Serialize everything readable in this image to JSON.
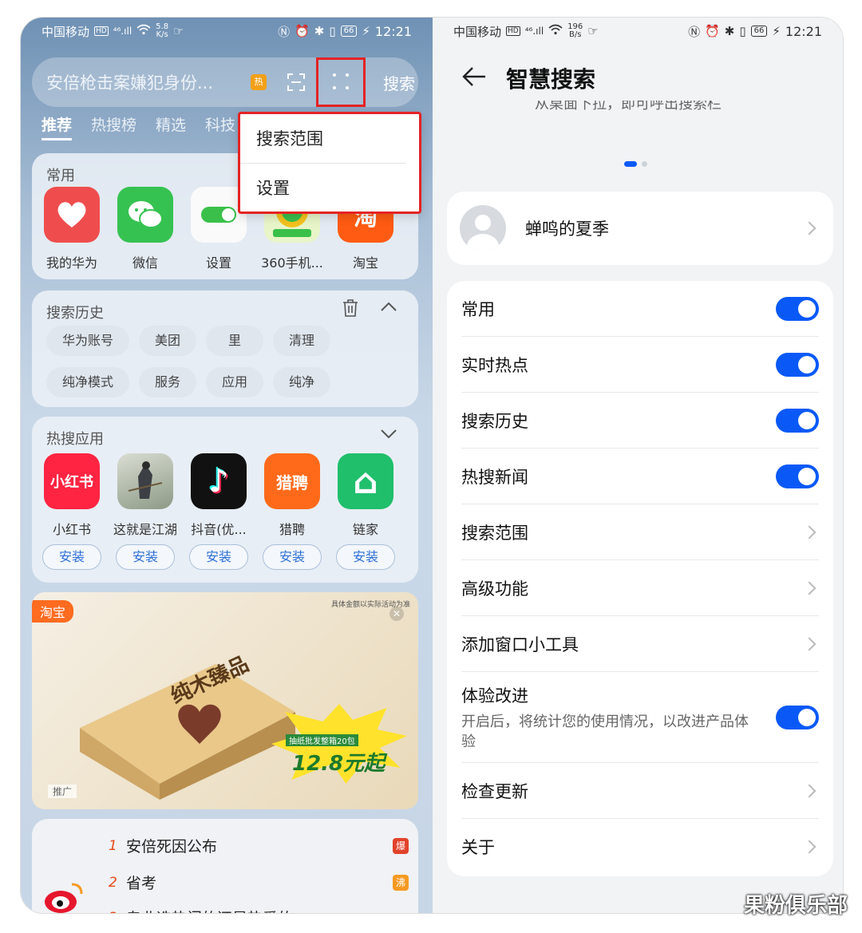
{
  "left_status": {
    "carrier": "中国移动",
    "hd": "HD",
    "signal": "⁴⁶.ıll",
    "speed_value": "5.8",
    "speed_unit": "K/s",
    "battery": "66",
    "time": "12:21"
  },
  "search": {
    "query": "安倍枪击案嫌犯身份...",
    "hot_badge": "热",
    "button": "搜索"
  },
  "tabs": [
    "推荐",
    "热搜榜",
    "精选",
    "科技"
  ],
  "menu": {
    "items": [
      "搜索范围",
      "设置"
    ]
  },
  "common": {
    "title": "常用",
    "apps": [
      {
        "label": "我的华为",
        "icon": "huawei-heart-icon",
        "color": "#ef4d4d"
      },
      {
        "label": "微信",
        "icon": "wechat-icon",
        "color": "#36c251"
      },
      {
        "label": "设置",
        "icon": "settings-toggle-icon",
        "color": "#ffffff"
      },
      {
        "label": "360手机...",
        "icon": "360-icon",
        "color": "#3ac04a"
      },
      {
        "label": "淘宝",
        "icon": "taobao-icon",
        "color": "#ff5b12"
      }
    ]
  },
  "history": {
    "title": "搜索历史",
    "chips": [
      "华为账号",
      "美团",
      "里",
      "清理",
      "纯净模式",
      "服务",
      "应用",
      "纯净"
    ]
  },
  "hot_apps": {
    "title": "热搜应用",
    "apps": [
      {
        "label": "小红书",
        "icon_text": "小红书",
        "color": "#ff2442"
      },
      {
        "label": "这就是江湖",
        "icon_text": "",
        "color": "#b8c0b4"
      },
      {
        "label": "抖音(优...",
        "icon_text": "♪",
        "color": "#111111"
      },
      {
        "label": "猎聘",
        "icon_text": "猎聘",
        "color": "#ff6a1a"
      },
      {
        "label": "链家",
        "icon_text": "⌂",
        "color": "#1fbf6c"
      }
    ],
    "install_label": "安装"
  },
  "ad": {
    "tag": "淘宝",
    "note": "具体金额以实际活动为准",
    "promo_tag": "推广",
    "headline": "纯木臻品",
    "price": "12.8元起",
    "sub": "抽纸批发整箱20包"
  },
  "news": {
    "items": [
      {
        "rank": "1",
        "title": "安倍死因公布",
        "badge": "爆",
        "badge_color": "#e2432b"
      },
      {
        "rank": "2",
        "title": "省考",
        "badge": "沸",
        "badge_color": "#f59a23"
      },
      {
        "rank": "3",
        "title": "专业选热门的还是热爱的",
        "badge": "",
        "badge_color": ""
      }
    ]
  },
  "right_status": {
    "carrier": "中国移动",
    "hd": "HD",
    "signal": "⁴⁶.ıll",
    "speed_value": "196",
    "speed_unit": "B/s",
    "battery": "66",
    "time": "12:21"
  },
  "settings_page": {
    "title": "智慧搜索",
    "intro_cut": "从桌面下拉，即可呼出搜索栏",
    "account_name": "蝉鸣的夏季",
    "rows": [
      {
        "label": "常用",
        "type": "toggle",
        "on": true
      },
      {
        "label": "实时热点",
        "type": "toggle",
        "on": true
      },
      {
        "label": "搜索历史",
        "type": "toggle",
        "on": true
      },
      {
        "label": "热搜新闻",
        "type": "toggle",
        "on": true
      },
      {
        "label": "搜索范围",
        "type": "link"
      },
      {
        "label": "高级功能",
        "type": "link"
      },
      {
        "label": "添加窗口小工具",
        "type": "link"
      },
      {
        "label": "体验改进",
        "type": "toggle",
        "on": true,
        "sub": "开启后，将统计您的使用情况，以改进产品体验"
      },
      {
        "label": "检查更新",
        "type": "link"
      },
      {
        "label": "关于",
        "type": "link"
      }
    ]
  },
  "watermark": "果粉俱乐部",
  "colors": {
    "accent": "#0a59f7",
    "highlight": "#e42323"
  }
}
